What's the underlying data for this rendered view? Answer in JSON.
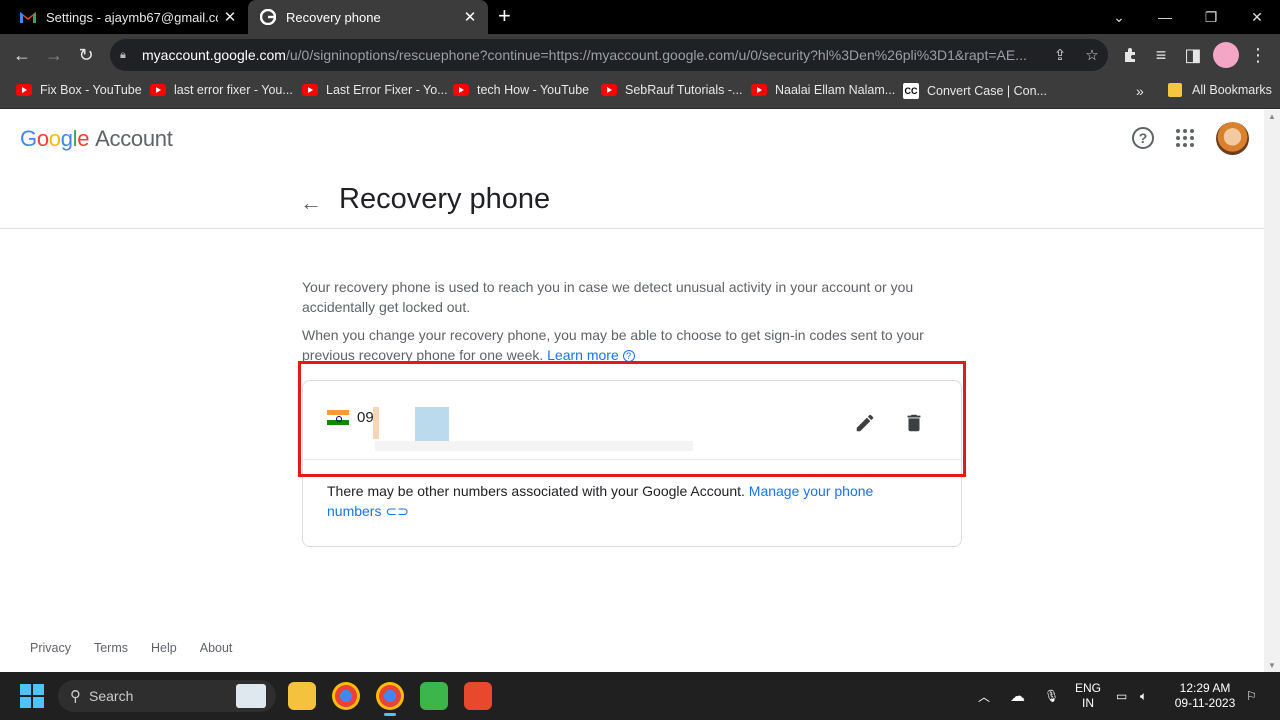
{
  "browser": {
    "tabs": [
      {
        "title": "Settings - ajaymb67@gmail.com",
        "icon": "gmail-icon"
      },
      {
        "title": "Recovery phone",
        "icon": "google-icon"
      }
    ],
    "url_host": "myaccount.google.com",
    "url_path": "/u/0/signinoptions/rescuephone?continue=https://myaccount.google.com/u/0/security?hl%3Den%26pli%3D1&rapt=AE...",
    "bookmarks": [
      {
        "label": "Fix Box - YouTube",
        "icon": "youtube-icon"
      },
      {
        "label": "last error fixer - You...",
        "icon": "youtube-icon"
      },
      {
        "label": "Last Error Fixer - Yo...",
        "icon": "youtube-icon"
      },
      {
        "label": "tech How - YouTube",
        "icon": "youtube-icon"
      },
      {
        "label": "SebRauf Tutorials -...",
        "icon": "youtube-icon"
      },
      {
        "label": "Naalai Ellam Nalam...",
        "icon": "youtube-icon"
      },
      {
        "label": "Convert Case | Con...",
        "icon": "cc-icon"
      }
    ],
    "all_bookmarks": "All Bookmarks",
    "overflow": "»"
  },
  "page": {
    "logo_account": "Account",
    "title": "Recovery phone",
    "para1": "Your recovery phone is used to reach you in case we detect unusual activity in your account or you accidentally get locked out.",
    "para2": "When you change your recovery phone, you may be able to choose to get sign-in codes sent to your previous recovery phone for one week.",
    "learn_more": "Learn more",
    "phone_prefix": "09",
    "card_text": "There may be other numbers associated with your Google Account.",
    "manage_link_1": "Manage your phone",
    "manage_link_2": "numbers",
    "footer": [
      "Privacy",
      "Terms",
      "Help",
      "About"
    ]
  },
  "taskbar": {
    "search_placeholder": "Search",
    "lang_top": "ENG",
    "lang_bottom": "IN",
    "time": "12:29 AM",
    "date": "09-11-2023"
  },
  "colors": {
    "accent_link": "#1a73e8",
    "highlight": "#e01b1b"
  }
}
